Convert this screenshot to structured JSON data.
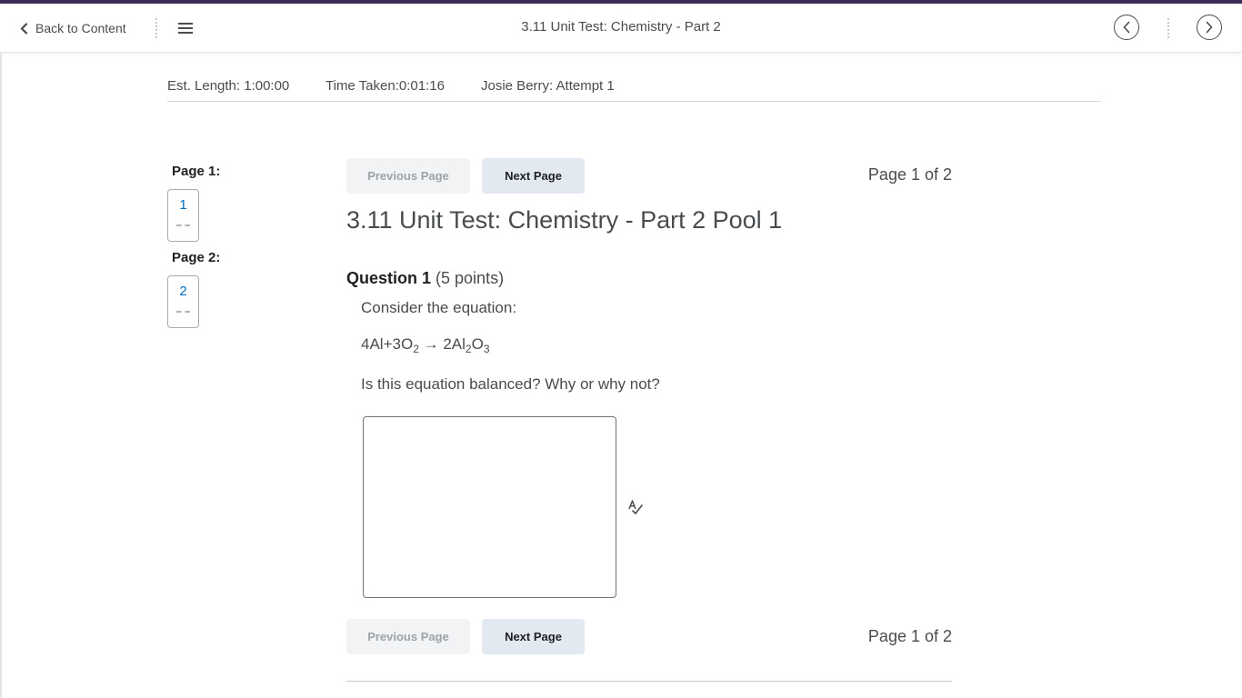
{
  "nav": {
    "back_label": "Back to Content",
    "title": "3.11 Unit Test: Chemistry - Part 2"
  },
  "info": {
    "est_length": "Est. Length: 1:00:00",
    "time_taken": "Time Taken:0:01:16",
    "attempt": "Josie Berry: Attempt 1"
  },
  "pages": [
    {
      "label": "Page 1:",
      "number": "1"
    },
    {
      "label": "Page 2:",
      "number": "2"
    }
  ],
  "pager": {
    "prev_label": "Previous Page",
    "next_label": "Next Page",
    "count": "Page 1 of 2"
  },
  "quiz": {
    "pool_title": "3.11 Unit Test: Chemistry - Part 2 Pool 1",
    "question_label": "Question 1",
    "points": "(5 points)",
    "prompt": "Consider the equation:",
    "equation": {
      "p1": "4Al+3O",
      "s1": "2",
      "p2": " → 2Al",
      "s2": "2",
      "p3": "O",
      "s3": "3"
    },
    "question": "Is this equation balanced? Why or why not?",
    "answer_value": ""
  },
  "colors": {
    "top_stripe": "#3d2a55",
    "link": "#006fbf"
  },
  "icons": [
    "chevron-left-icon",
    "menu-icon",
    "circle-arrow-left-icon",
    "circle-arrow-right-icon",
    "spellcheck-icon"
  ]
}
